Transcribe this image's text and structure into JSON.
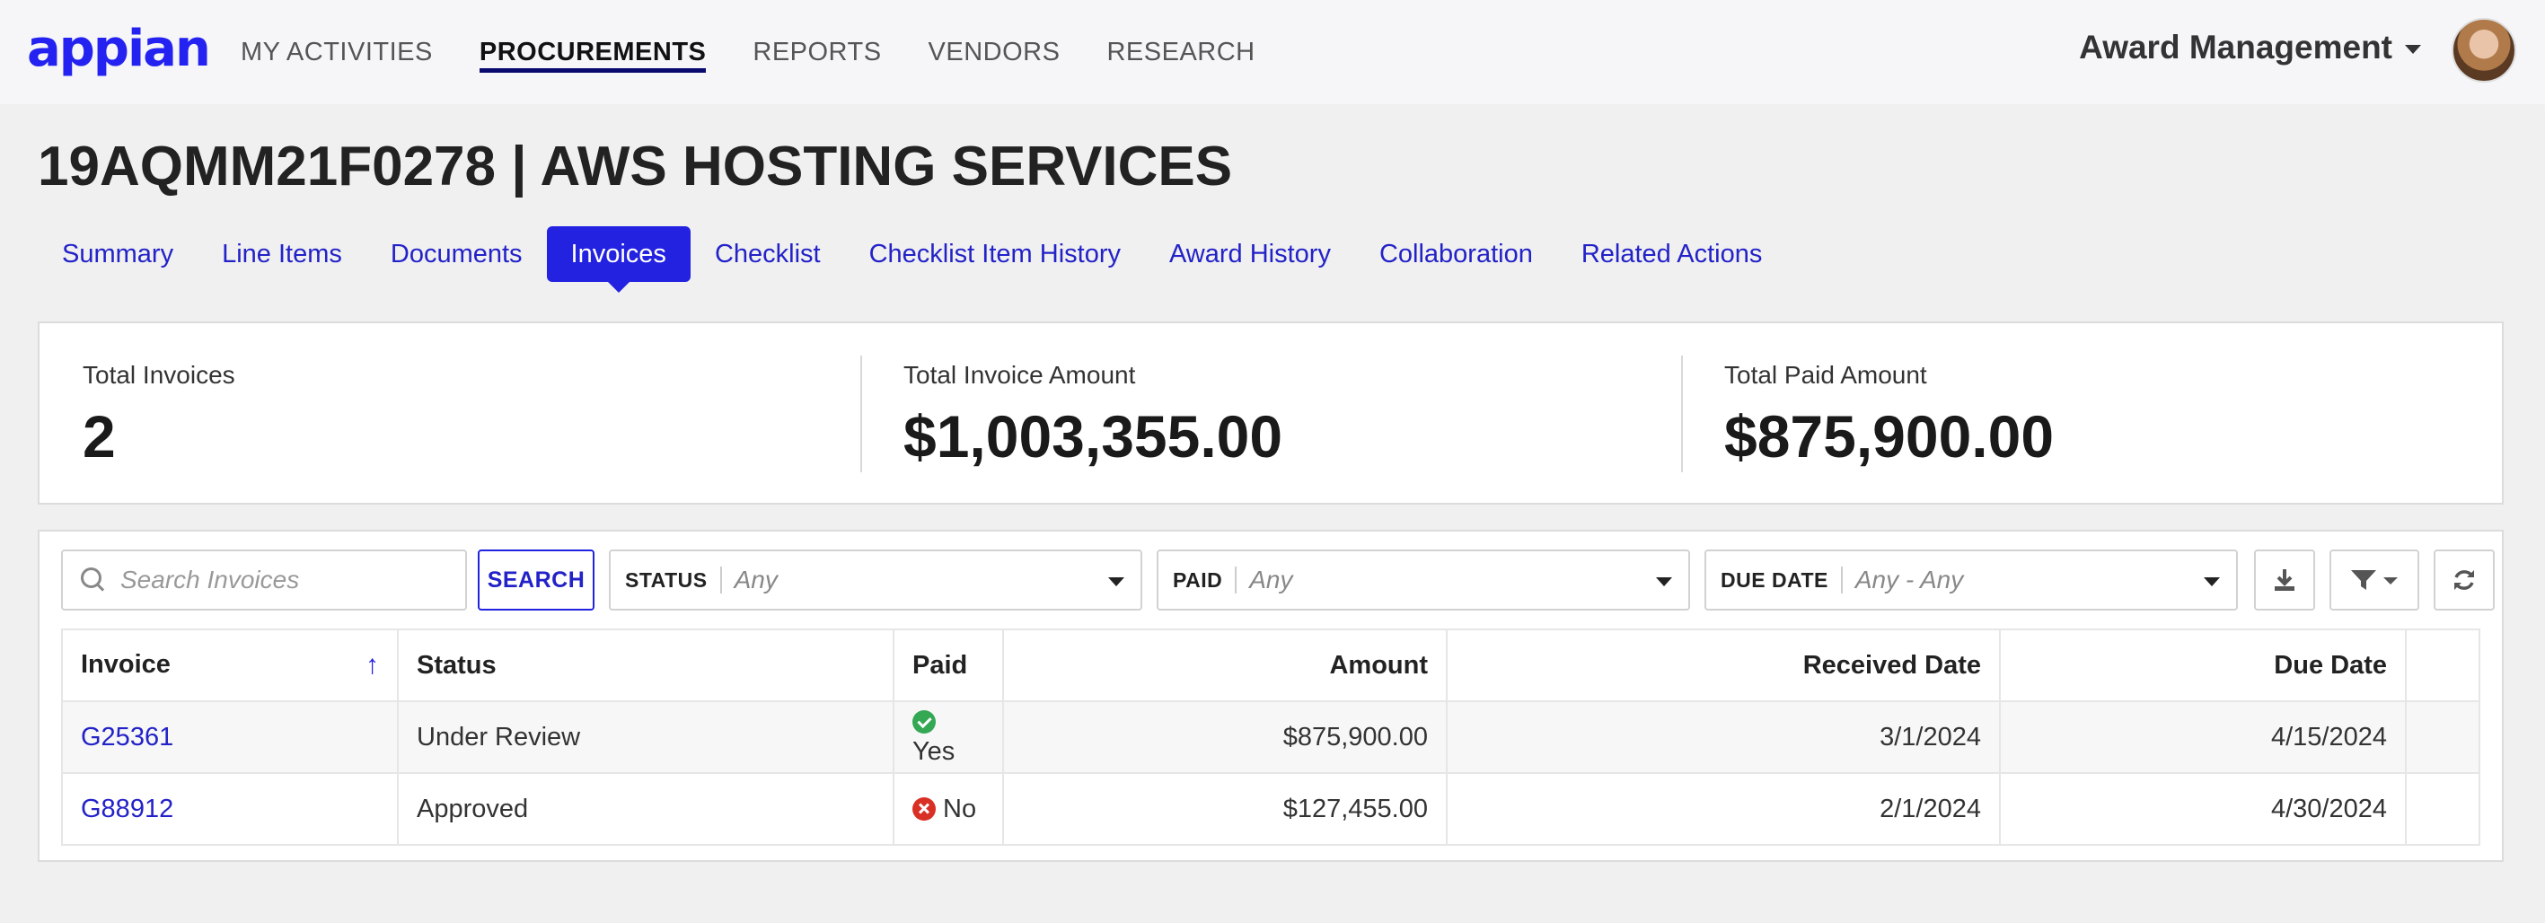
{
  "brand": {
    "logo_text": "appian"
  },
  "nav": {
    "items": [
      {
        "label": "MY ACTIVITIES"
      },
      {
        "label": "PROCUREMENTS"
      },
      {
        "label": "REPORTS"
      },
      {
        "label": "VENDORS"
      },
      {
        "label": "RESEARCH"
      }
    ],
    "active": "PROCUREMENTS",
    "site_menu_label": "Award Management"
  },
  "page": {
    "title": "19AQMM21F0278 | AWS HOSTING SERVICES"
  },
  "tabs": [
    {
      "label": "Summary"
    },
    {
      "label": "Line Items"
    },
    {
      "label": "Documents"
    },
    {
      "label": "Invoices"
    },
    {
      "label": "Checklist"
    },
    {
      "label": "Checklist Item History"
    },
    {
      "label": "Award History"
    },
    {
      "label": "Collaboration"
    },
    {
      "label": "Related Actions"
    }
  ],
  "active_tab": "Invoices",
  "kpis": [
    {
      "label": "Total Invoices",
      "value": "2"
    },
    {
      "label": "Total Invoice Amount",
      "value": "$1,003,355.00"
    },
    {
      "label": "Total Paid Amount",
      "value": "$875,900.00"
    }
  ],
  "toolbar": {
    "search_placeholder": "Search Invoices",
    "search_button": "SEARCH",
    "filters": [
      {
        "label": "STATUS",
        "value": "Any"
      },
      {
        "label": "PAID",
        "value": "Any"
      },
      {
        "label": "DUE DATE",
        "value": "Any - Any"
      }
    ]
  },
  "table": {
    "columns": [
      "Invoice",
      "Status",
      "Paid",
      "Amount",
      "Received Date",
      "Due Date"
    ],
    "sort_indicator": "↑",
    "rows": [
      {
        "invoice": "G25361",
        "status": "Under Review",
        "paid": "Yes",
        "amount": "$875,900.00",
        "received": "3/1/2024",
        "due": "4/15/2024"
      },
      {
        "invoice": "G88912",
        "status": "Approved",
        "paid": "No",
        "amount": "$127,455.00",
        "received": "2/1/2024",
        "due": "4/30/2024"
      }
    ]
  },
  "colors": {
    "accent": "#2322e0",
    "yes": "#34a853",
    "no": "#d93025"
  }
}
